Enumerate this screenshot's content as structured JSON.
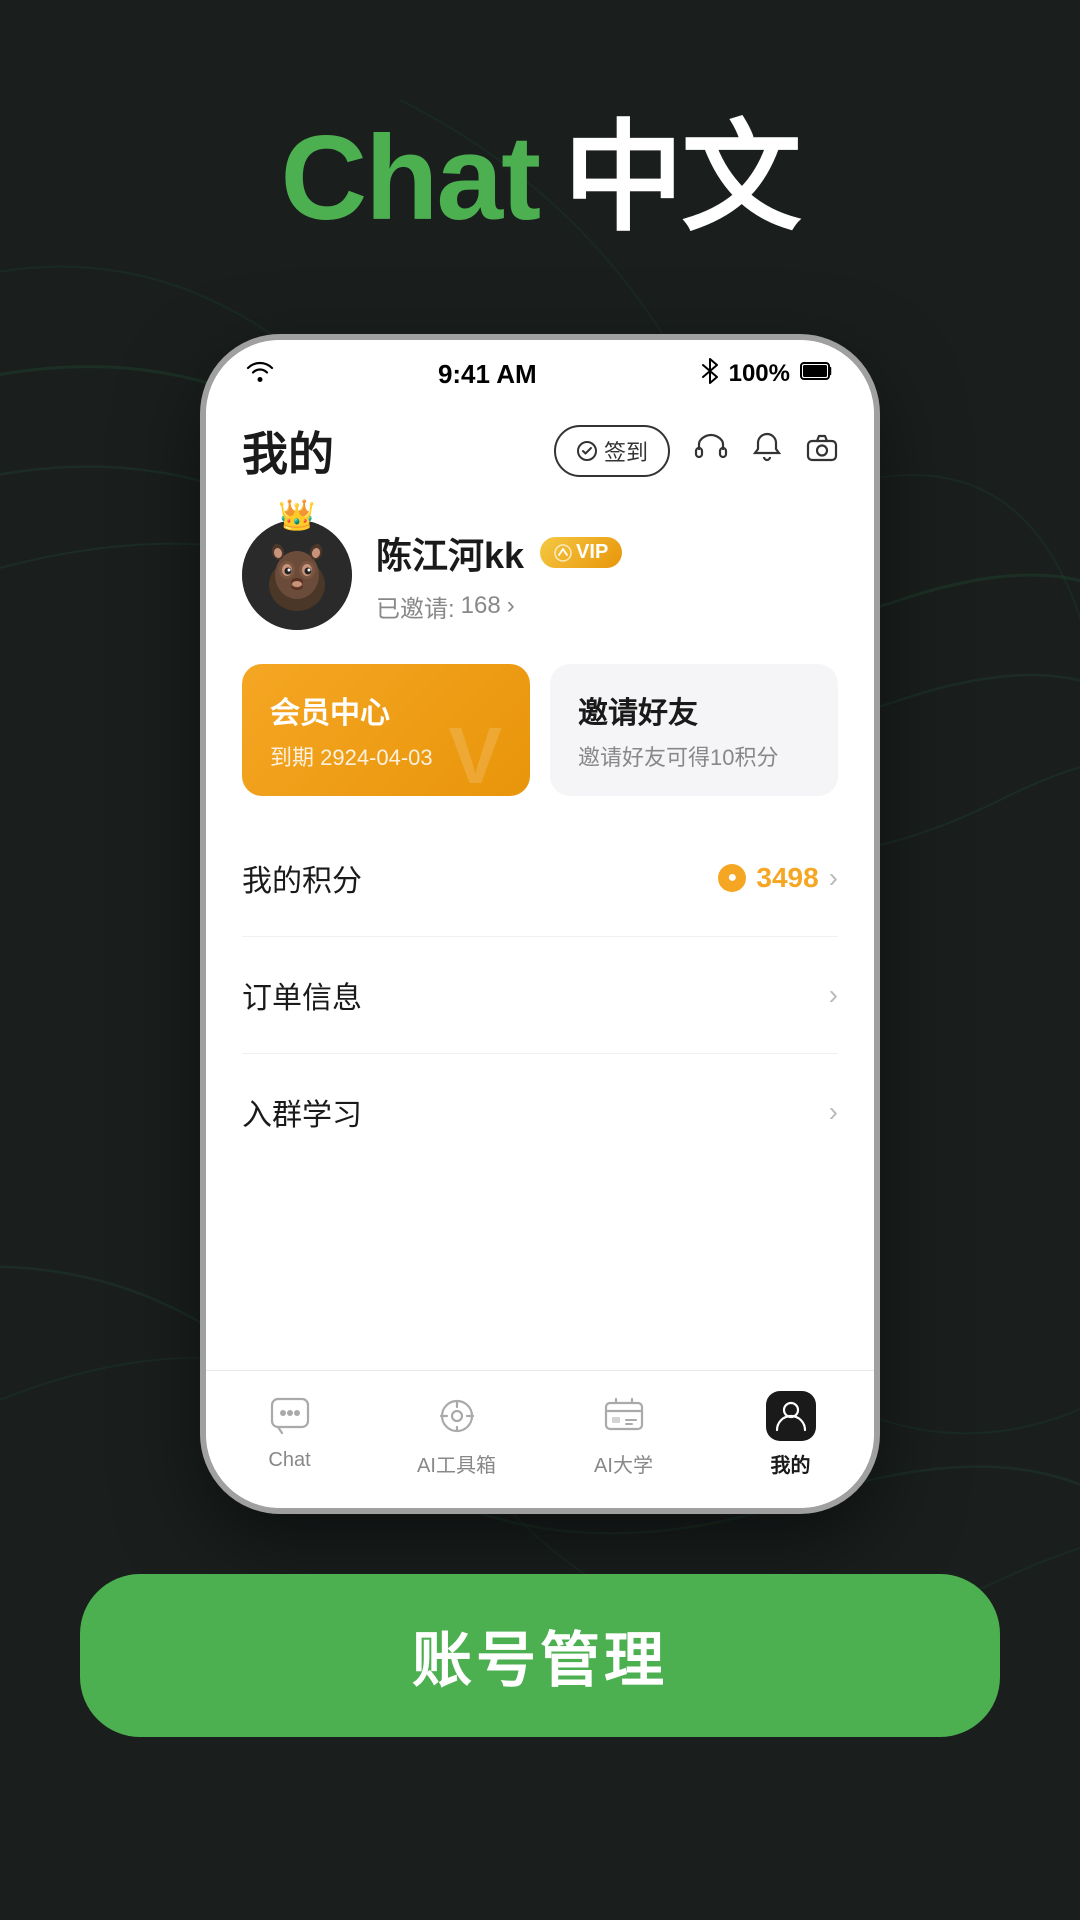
{
  "page": {
    "title_chat": "Chat",
    "title_chinese": "中文",
    "background_color": "#1a1f1e"
  },
  "status_bar": {
    "time": "9:41 AM",
    "battery": "100%",
    "wifi_icon": "wifi",
    "bluetooth_icon": "bluetooth"
  },
  "header": {
    "title": "我的",
    "sign_in_label": "签到",
    "headphone_icon": "headphone",
    "bell_icon": "bell",
    "camera_icon": "camera"
  },
  "profile": {
    "name": "陈江河kk",
    "vip_label": "VIP",
    "invited_prefix": "已邀请:",
    "invited_count": "168",
    "invited_chevron": "›"
  },
  "cards": {
    "member": {
      "title": "会员中心",
      "expire_label": "到期 2924-04-03"
    },
    "invite": {
      "title": "邀请好友",
      "desc": "邀请好友可得10积分"
    }
  },
  "menu_items": [
    {
      "label": "我的积分",
      "value": "3498",
      "has_coin": true,
      "has_chevron": true
    },
    {
      "label": "订单信息",
      "value": "",
      "has_coin": false,
      "has_chevron": true
    },
    {
      "label": "入群学习",
      "value": "",
      "has_coin": false,
      "has_chevron": true
    }
  ],
  "bottom_nav": [
    {
      "label": "Chat",
      "icon": "chat",
      "active": false
    },
    {
      "label": "AI工具箱",
      "icon": "toolbox",
      "active": false
    },
    {
      "label": "AI大学",
      "icon": "university",
      "active": false
    },
    {
      "label": "我的",
      "icon": "profile",
      "active": true
    }
  ],
  "bottom_button": {
    "label": "账号管理"
  }
}
